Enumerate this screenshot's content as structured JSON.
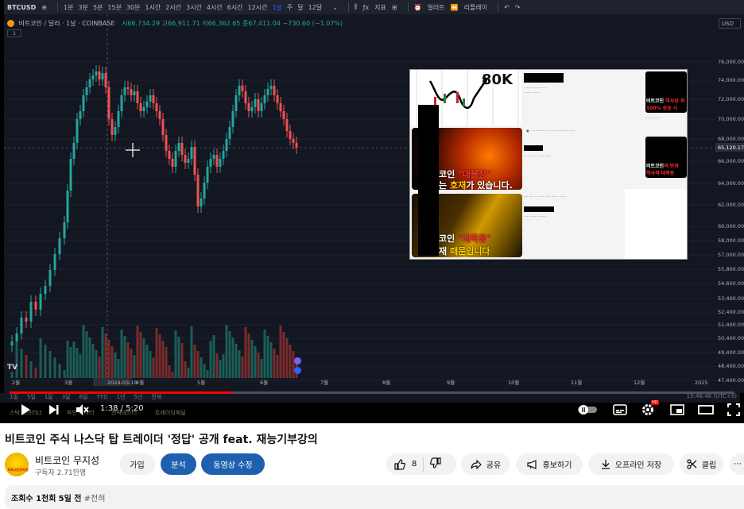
{
  "tradingview": {
    "symbol": "BTCUSD",
    "intervals": [
      "1분",
      "3분",
      "5분",
      "15분",
      "30분",
      "1시간",
      "2시간",
      "3시간",
      "4시간",
      "6시간",
      "12시간",
      "1날",
      "주",
      "달",
      "12달"
    ],
    "indicators_label": "지표",
    "alert_label": "얼러트",
    "replay_label": "리플레이",
    "header_title": "비트코인 / 달러 · 1날 · COINBASE",
    "ohlc": "시66,734.29 고66,911.71 저66,362.65 종67,411.04 −730.60 (−1.07%)",
    "currency": "USD",
    "collapse": "1",
    "price_axis": [
      "76,000.00",
      "74,000.00",
      "72,000.00",
      "70,000.00",
      "68,000.00",
      "66,000.00",
      "64,000.00",
      "62,000.00",
      "60,000.00",
      "58,000.00",
      "57,000.00",
      "55,800.00",
      "54,600.00",
      "53,400.00",
      "52,400.00",
      "51,400.00",
      "50,400.00",
      "49,400.00",
      "48,400.00",
      "47,400.00"
    ],
    "current_price": "65,120.17",
    "time_axis": [
      "2월",
      "3월",
      "2024-03-18",
      "4월",
      "5월",
      "6월",
      "7월",
      "8월",
      "9월",
      "10월",
      "11월",
      "12월",
      "2025"
    ],
    "ranges": [
      "1일",
      "5일",
      "1달",
      "3달",
      "6달",
      "YTD",
      "1년",
      "5년",
      "전체"
    ],
    "clock": "15:46:48 (UTC+9)",
    "bottom_tabs": [
      "스탁 스크리너",
      "파인 에디터",
      "전략테스터",
      "트레이딩패널"
    ]
  },
  "overlay": {
    "big_text": "80K",
    "thumb1": {
      "line1": "코인 ",
      "line1_red": "\"대불장\"",
      "line2": "는 ",
      "line2_yel": "호재",
      "line2_end": "가 있습니다."
    },
    "thumb2": {
      "line1": "코인 ",
      "line1_red": "\"대폭등\"",
      "line2": "재 ",
      "line2_red": "때문입니다"
    },
    "side1": {
      "top": "비트코인 ",
      "top_red": "역사상 최",
      "mid": "100% 상승 시"
    },
    "side2": {
      "top": "비트코인",
      "top_red": "의 반격",
      "mid": "역사적 대폭등"
    }
  },
  "player": {
    "time": "1:38 / 5:20",
    "progress": 0.306
  },
  "video": {
    "title": "비트코인 주식 나스닥 탑 트레이더 '정답' 공개 feat. 재능기부강의",
    "channel": "비트코인 무지성",
    "subscribers": "구독자 2.71만명",
    "avatar_text": "비트코인무지성",
    "join": "가입",
    "analytics": "분석",
    "edit": "동영상 수정",
    "likes": "8",
    "share": "공유",
    "promote": "홍보하기",
    "download": "오프라인 저장",
    "clip": "클립",
    "views": "조회수 1천회",
    "age": "5일 전",
    "hashtag": "#전혀"
  }
}
